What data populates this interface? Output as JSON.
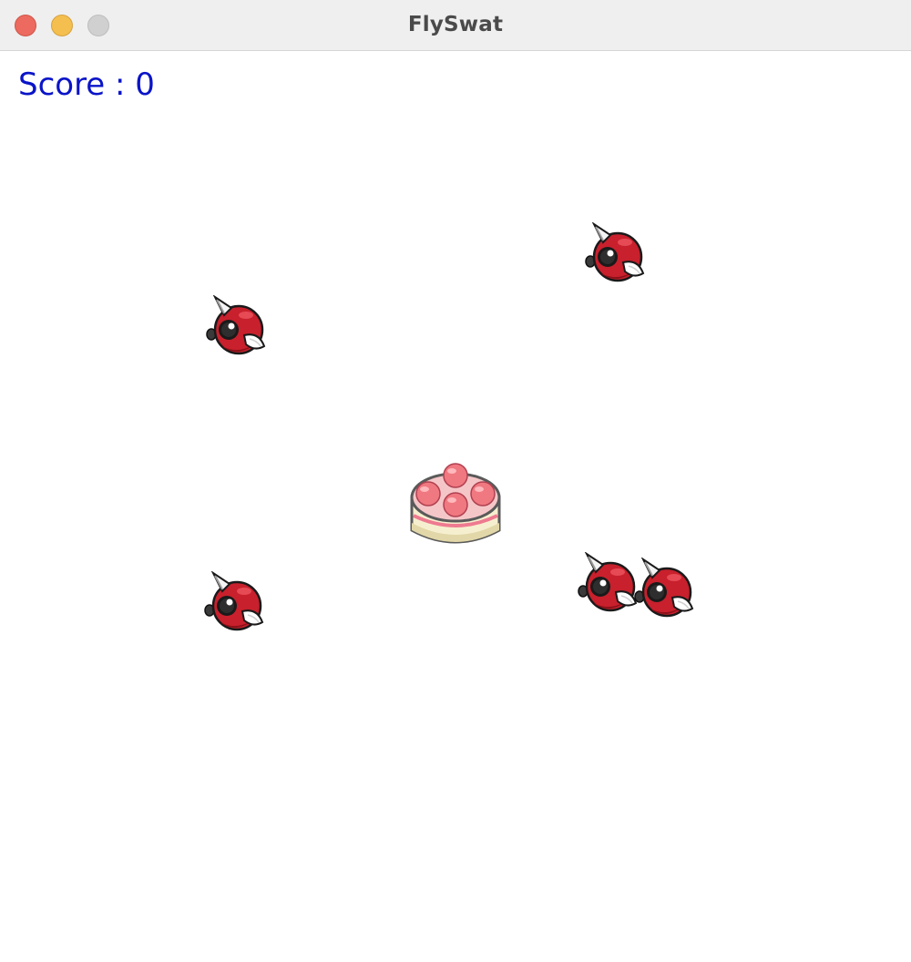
{
  "window": {
    "title": "FlySwat"
  },
  "hud": {
    "score_label": "Score : 0",
    "score": 0
  },
  "colors": {
    "score_text": "#0a14c8",
    "fly_body": "#c8202c",
    "cake_frosting": "#f07880"
  },
  "sprites": {
    "fly_icon": "red-fly-sprite",
    "cake_icon": "strawberry-cake-sprite",
    "fly_count": 5
  }
}
